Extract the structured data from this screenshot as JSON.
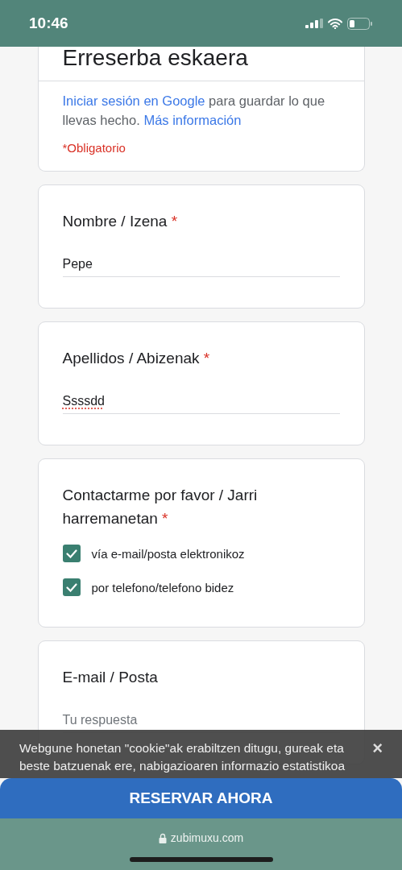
{
  "status_bar": {
    "time": "10:46"
  },
  "form": {
    "title": "Erreserba eskaera",
    "signin_link": "Iniciar sesión en Google",
    "signin_text": "para guardar lo que llevas hecho.",
    "more_link": "Más información",
    "required_note": "*Obligatorio"
  },
  "questions": [
    {
      "kind": "text",
      "label": "Nombre / Izena",
      "required_mark": "*",
      "value": "Pepe",
      "misspelled": false
    },
    {
      "kind": "text",
      "label": "Apellidos / Abizenak",
      "required_mark": "*",
      "value": "Ssssdd",
      "misspelled": true
    },
    {
      "kind": "checkboxes",
      "label": "Contactarme por favor / Jarri harremanetan",
      "required_mark": "*",
      "options": [
        {
          "label": "vía e-mail/posta elektronikoz",
          "checked": true
        },
        {
          "label": "por telefono/telefono bidez",
          "checked": true
        }
      ]
    },
    {
      "kind": "text",
      "label": "E-mail / Posta",
      "placeholder": "Tu respuesta"
    }
  ],
  "cookie_banner": {
    "text": "Webgune honetan \"cookie\"ak erabiltzen ditugu, gureak eta beste batzuenak ere, nabigazioaren informazio estatistikoa",
    "close": "×"
  },
  "cta_button": "RESERVAR AHORA",
  "url_bar": {
    "url": "zubimuxu.com"
  }
}
